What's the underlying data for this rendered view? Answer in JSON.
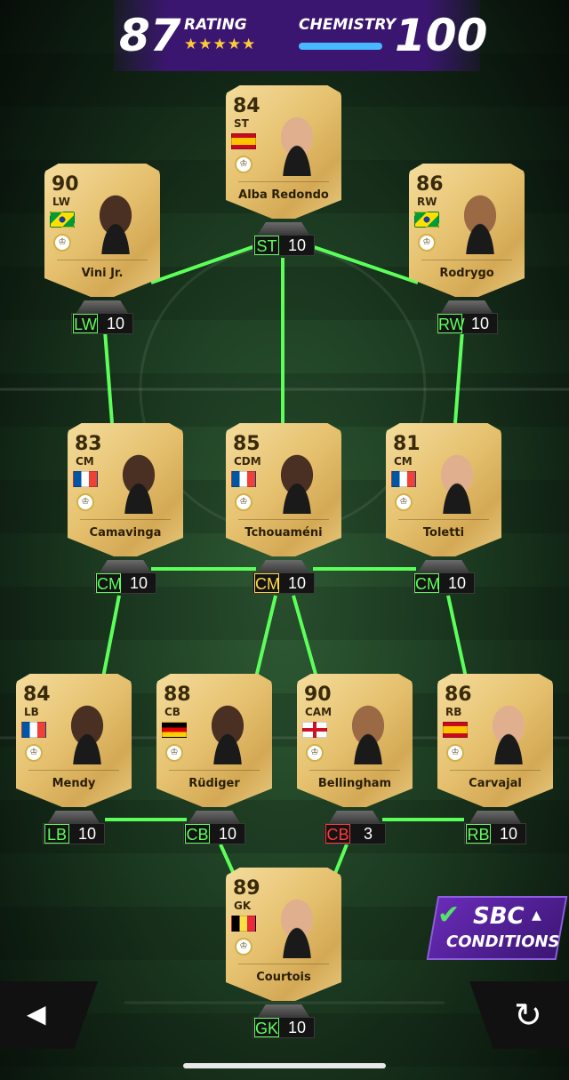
{
  "header": {
    "rating_value": "87",
    "rating_label": "RATING",
    "stars": "★★★★★",
    "chemistry_label": "CHEMISTRY",
    "chemistry_value": "100"
  },
  "colors": {
    "link_green": "#5cff5a",
    "bad_red": "#ff3a3a",
    "card_gold": "#e6c270",
    "sbc_purple": "#5a23a4"
  },
  "players": {
    "st": {
      "rating": "84",
      "position": "ST",
      "name": "Alba Redondo",
      "flag": "spain-flag"
    },
    "lw": {
      "rating": "90",
      "position": "LW",
      "name": "Vini Jr.",
      "flag": "brazil-flag"
    },
    "rw": {
      "rating": "86",
      "position": "RW",
      "name": "Rodrygo",
      "flag": "brazil-flag"
    },
    "lcm": {
      "rating": "83",
      "position": "CM",
      "name": "Camavinga",
      "flag": "france-flag"
    },
    "cdm": {
      "rating": "85",
      "position": "CDM",
      "name": "Tchouaméni",
      "flag": "france-flag"
    },
    "rcm": {
      "rating": "81",
      "position": "CM",
      "name": "Toletti",
      "flag": "france-flag"
    },
    "lb": {
      "rating": "84",
      "position": "LB",
      "name": "Mendy",
      "flag": "france-flag"
    },
    "cb": {
      "rating": "88",
      "position": "CB",
      "name": "Rüdiger",
      "flag": "germany-flag"
    },
    "cam": {
      "rating": "90",
      "position": "CAM",
      "name": "Bellingham",
      "flag": "england-flag"
    },
    "rb": {
      "rating": "86",
      "position": "RB",
      "name": "Carvajal",
      "flag": "spain-flag"
    },
    "gk": {
      "rating": "89",
      "position": "GK",
      "name": "Courtois",
      "flag": "belgium-flag"
    }
  },
  "slots": {
    "st": {
      "pos": "ST",
      "chem": "10"
    },
    "lw": {
      "pos": "LW",
      "chem": "10"
    },
    "rw": {
      "pos": "RW",
      "chem": "10"
    },
    "lcm": {
      "pos": "CM",
      "chem": "10"
    },
    "cm": {
      "pos": "CM",
      "chem": "10"
    },
    "rcm": {
      "pos": "CM",
      "chem": "10"
    },
    "lb": {
      "pos": "LB",
      "chem": "10"
    },
    "cb": {
      "pos": "CB",
      "chem": "10"
    },
    "cb2": {
      "pos": "CB",
      "chem": "3"
    },
    "rb": {
      "pos": "RB",
      "chem": "10"
    },
    "gk": {
      "pos": "GK",
      "chem": "10"
    }
  },
  "sbc": {
    "check": "✔",
    "title": "SBC",
    "arrow": "▲",
    "subtitle": "CONDITIONS"
  },
  "nav": {
    "back_icon": "◀",
    "reset_icon": "↻"
  }
}
